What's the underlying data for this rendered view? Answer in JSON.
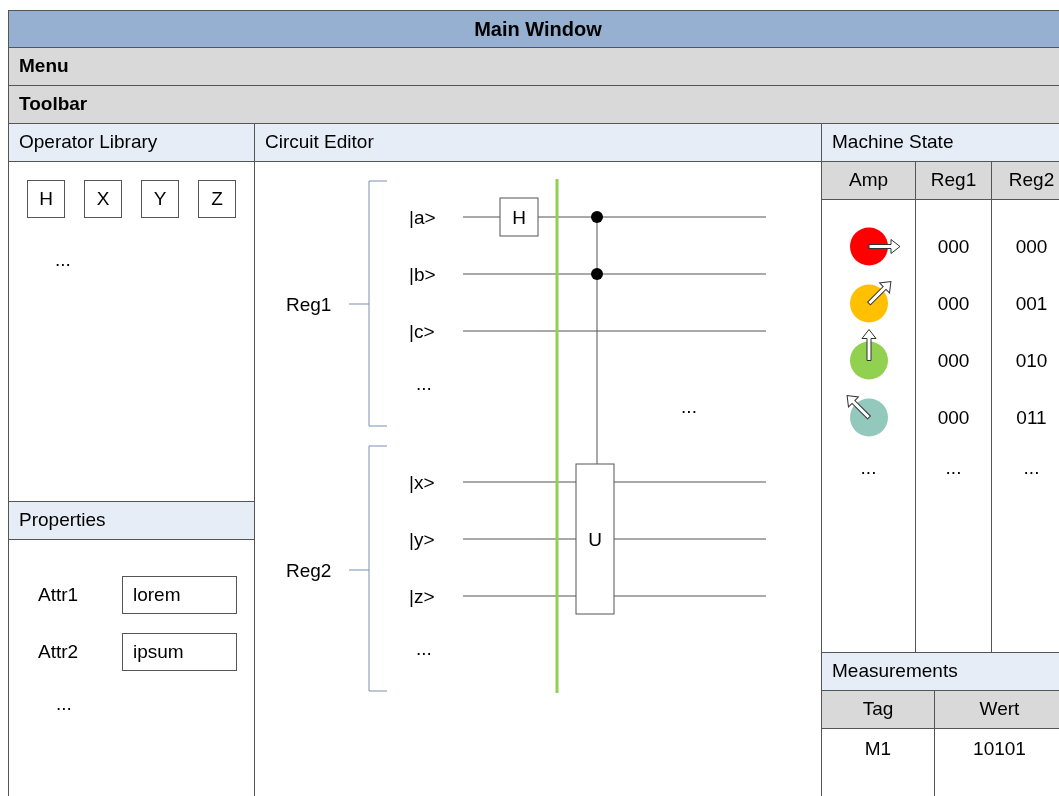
{
  "window": {
    "title": "Main Window"
  },
  "menu": {
    "label": "Menu"
  },
  "toolbar": {
    "label": "Toolbar"
  },
  "operator_library": {
    "title": "Operator Library",
    "operators": [
      "H",
      "X",
      "Y",
      "Z"
    ],
    "more": "..."
  },
  "properties": {
    "title": "Properties",
    "attributes": [
      {
        "label": "Attr1",
        "value": "lorem"
      },
      {
        "label": "Attr2",
        "value": "ipsum"
      }
    ],
    "more": "..."
  },
  "circuit_editor": {
    "title": "Circuit Editor",
    "registers": [
      {
        "name": "Reg1",
        "qubits": [
          "|a>",
          "|b>",
          "|c>"
        ],
        "more": "..."
      },
      {
        "name": "Reg2",
        "qubits": [
          "|x>",
          "|y>",
          "|z>"
        ],
        "more": "..."
      }
    ],
    "gates": [
      {
        "kind": "single",
        "label": "H"
      },
      {
        "kind": "controlled",
        "label": "U"
      }
    ],
    "more": "..."
  },
  "machine_state": {
    "title": "Machine State",
    "columns": [
      "Amp",
      "Reg1",
      "Reg2"
    ],
    "rows": [
      {
        "color": "#ff0000",
        "kind": "east",
        "reg1": "000",
        "reg2": "000"
      },
      {
        "color": "#ffc000",
        "kind": "northeast",
        "reg1": "000",
        "reg2": "001"
      },
      {
        "color": "#92d050",
        "kind": "north",
        "reg1": "000",
        "reg2": "010"
      },
      {
        "color": "#93c8bc",
        "kind": "northwest",
        "reg1": "000",
        "reg2": "011"
      }
    ],
    "more": [
      "...",
      "...",
      "..."
    ]
  },
  "measurements": {
    "title": "Measurements",
    "columns": [
      "Tag",
      "Wert"
    ],
    "rows": [
      [
        "M1",
        "10101"
      ]
    ]
  }
}
